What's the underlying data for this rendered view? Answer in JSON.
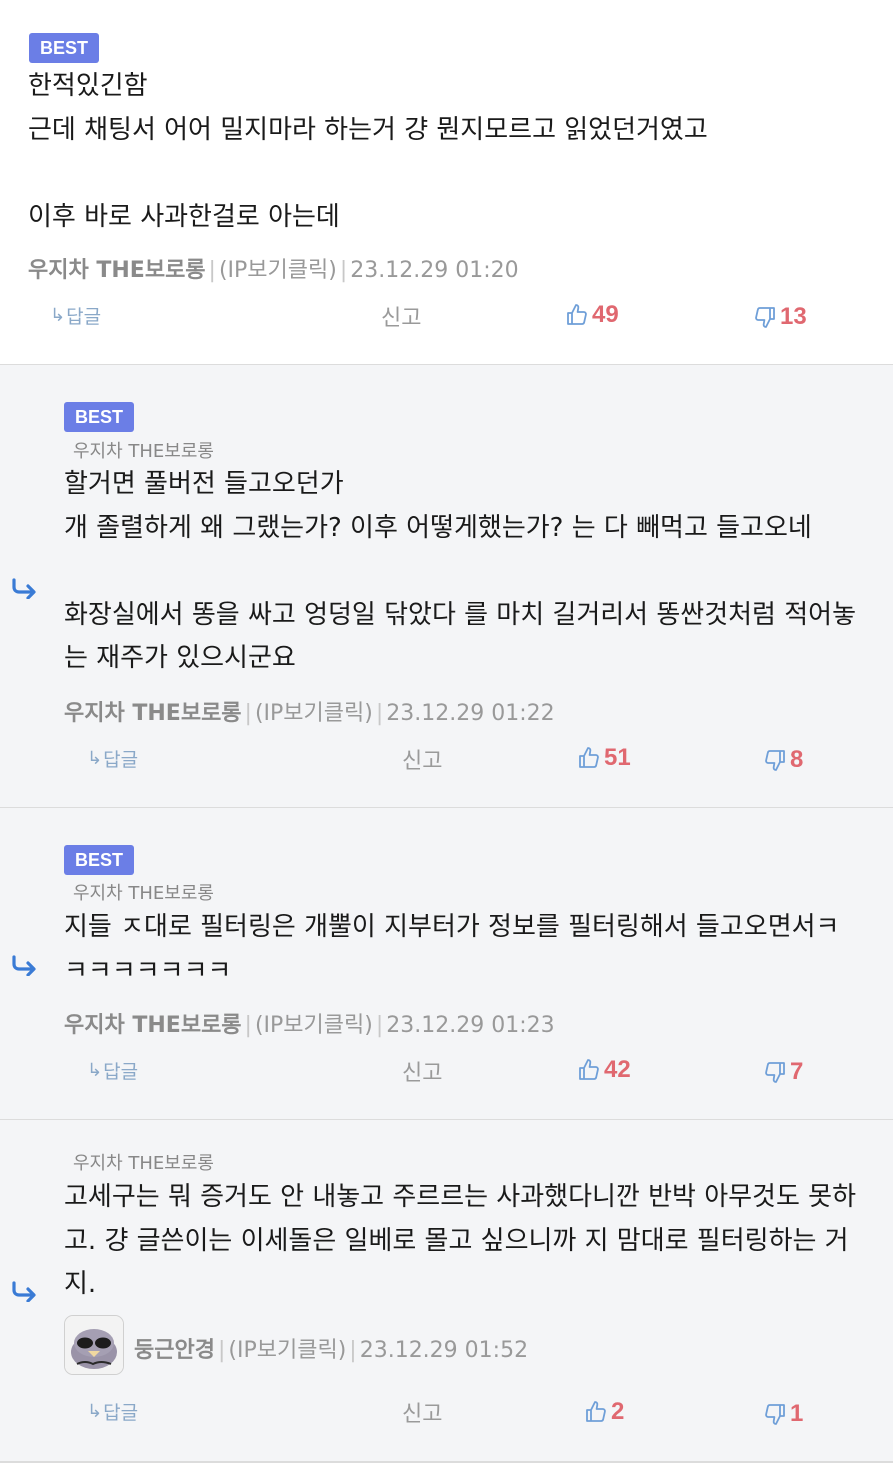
{
  "best_label": "BEST",
  "action_labels": {
    "reply": "답글",
    "report": "신고"
  },
  "comments": [
    {
      "best": true,
      "body": "한적있긴함\n근데 채팅서 어어 밀지마라 하는거 걍 뭔지모르고 읽었던거였고\n\n이후 바로 사과한걸로 아는데",
      "author": "우지차 THE보로롱",
      "ip": "(IP보기클릭)",
      "timestamp": "23.12.29 01:20",
      "likes": "49",
      "dislikes": "13"
    },
    {
      "best": true,
      "reply_to": "우지차 THE보로롱",
      "body": "할거면 풀버전 들고오던가\n개 졸렬하게 왜 그랬는가? 이후 어떻게했는가? 는 다 빼먹고 들고오네\n\n화장실에서 똥을 싸고 엉덩일 닦았다 를 마치 길거리서 똥싼것처럼 적어놓\n는 재주가 있으시군요",
      "author": "우지차 THE보로롱",
      "ip": "(IP보기클릭)",
      "timestamp": "23.12.29 01:22",
      "likes": "51",
      "dislikes": "8"
    },
    {
      "best": true,
      "reply_to": "우지차 THE보로롱",
      "body": "지들 ㅈ대로 필터링은 개뿔이 지부터가 정보를 필터링해서 들고오면서ㅋ\nㅋㅋㅋㅋㅋㅋㅋ",
      "author": "우지차 THE보로롱",
      "ip": "(IP보기클릭)",
      "timestamp": "23.12.29 01:23",
      "likes": "42",
      "dislikes": "7"
    },
    {
      "best": false,
      "reply_to": "우지차 THE보로롱",
      "body": "고세구는 뭐 증거도 안 내놓고 주르르는 사과했다니깐 반박 아무것도 못하\n고. 걍 글쓴이는 이세돌은 일베로 몰고 싶으니까 지 맘대로 필터링하는 거\n지.",
      "author": "둥근안경",
      "ip": "(IP보기클릭)",
      "timestamp": "23.12.29 01:52",
      "likes": "2",
      "dislikes": "1"
    }
  ],
  "colors": {
    "best_badge": "#6b7ee6",
    "vote_count": "#e06870",
    "vote_icon": "#6f9fd8",
    "reply_arrow": "#3a7bd5",
    "reply_bg": "#f4f5f7"
  }
}
